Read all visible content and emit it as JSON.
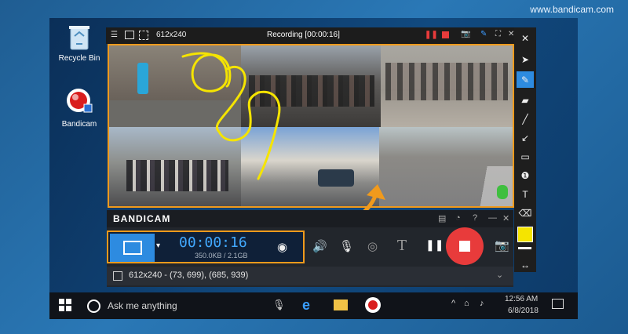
{
  "website": "www.bandicam.com",
  "desktop": {
    "icons": [
      {
        "label": "Recycle Bin",
        "icon": "recycle-bin-icon"
      },
      {
        "label": "Bandicam",
        "icon": "bandicam-app-icon"
      }
    ]
  },
  "recording_window": {
    "resolution": "612x240",
    "title": "Recording [00:00:16]"
  },
  "bandicam": {
    "brand": "BANDICAM",
    "timer": "00:00:16",
    "size": "350.0KB / 2.1GB",
    "region_text": "612x240 - (73, 699), (685, 939)"
  },
  "colors": {
    "accent": "#f09a1c",
    "record": "#e83b3b",
    "mode_blue": "#2d8be0",
    "highlight": "#f5e400"
  },
  "taskbar": {
    "search_placeholder": "Ask me anything",
    "time": "12:56 AM",
    "date": "6/8/2018"
  }
}
